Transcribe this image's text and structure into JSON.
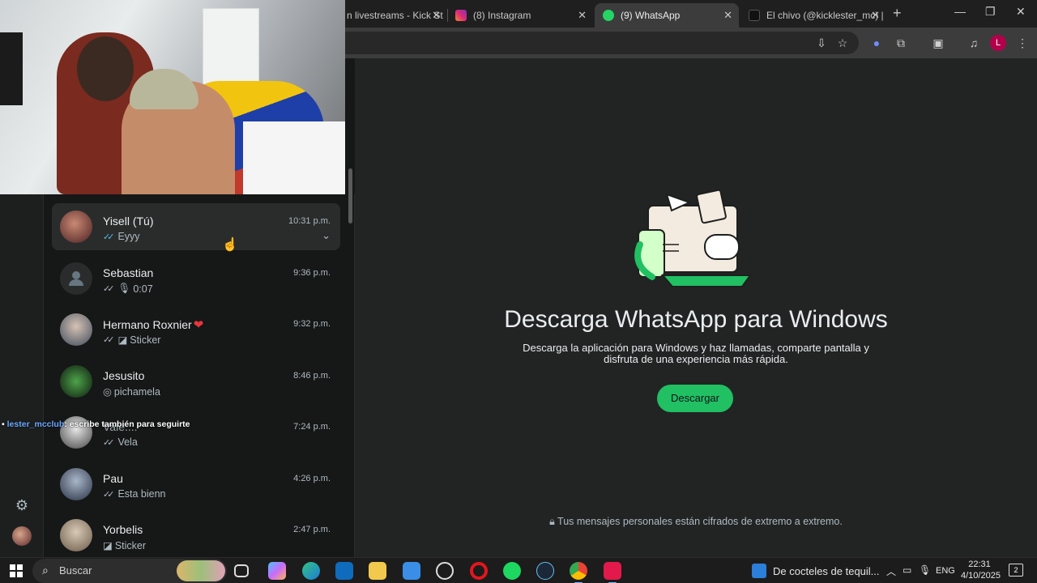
{
  "browser": {
    "tabs": [
      {
        "label": "n livestreams - Kick St",
        "favicon": "kick-icon",
        "active": false
      },
      {
        "label": "(8) Instagram",
        "favicon": "instagram-icon",
        "active": false
      },
      {
        "label": "(9) WhatsApp",
        "favicon": "whatsapp-icon",
        "active": true
      },
      {
        "label": "El chivo (@kicklester_mc) | T",
        "favicon": "tiktok-icon",
        "active": false
      }
    ],
    "new_tab_glyph": "+",
    "profile_initial": "L"
  },
  "overlay_chat": {
    "user": "lester_mcclub",
    "message": "escribe también para seguirte"
  },
  "chats": [
    {
      "name": "Yisell (Tú)",
      "time": "10:31 p.m.",
      "preview": "Eyyy",
      "tick": "read",
      "preview_icon": "",
      "selected": true
    },
    {
      "name": "Sebastian",
      "time": "9:36 p.m.",
      "preview": "0:07",
      "tick": "sent",
      "preview_icon": "mic-icon",
      "selected": false
    },
    {
      "name": "Hermano Roxnier",
      "time": "9:32 p.m.",
      "preview": "Sticker",
      "tick": "sent",
      "preview_icon": "sticker-icon",
      "selected": false
    },
    {
      "name": "Jesusito",
      "time": "8:46 p.m.",
      "preview": "pichamela",
      "tick": "",
      "preview_icon": "view-once-icon",
      "selected": false
    },
    {
      "name": "Vale....",
      "time": "7:24 p.m.",
      "preview": "Vela",
      "tick": "sent",
      "preview_icon": "",
      "selected": false
    },
    {
      "name": "Pau",
      "time": "4:26 p.m.",
      "preview": "Esta bienn",
      "tick": "sent",
      "preview_icon": "",
      "selected": false
    },
    {
      "name": "Yorbelis",
      "time": "2:47 p.m.",
      "preview": "Sticker",
      "tick": "",
      "preview_icon": "sticker-icon",
      "selected": false
    }
  ],
  "main": {
    "title": "Descarga WhatsApp para Windows",
    "subtitle": "Descarga la aplicación para Windows y haz llamadas, comparte pantalla y disfruta de una experiencia más rápida.",
    "download_label": "Descargar",
    "encryption_note": "Tus mensajes personales están cifrados de extremo a extremo."
  },
  "taskbar": {
    "search_placeholder": "Buscar",
    "weather_text": "De cocteles de tequil...",
    "language": "ENG",
    "time": "22:31",
    "date": "4/10/2025",
    "notification_count": "2"
  },
  "colors": {
    "accent_green": "#21c063",
    "read_tick_blue": "#53bdeb",
    "panel_bg": "#222424",
    "list_bg": "#161717"
  }
}
